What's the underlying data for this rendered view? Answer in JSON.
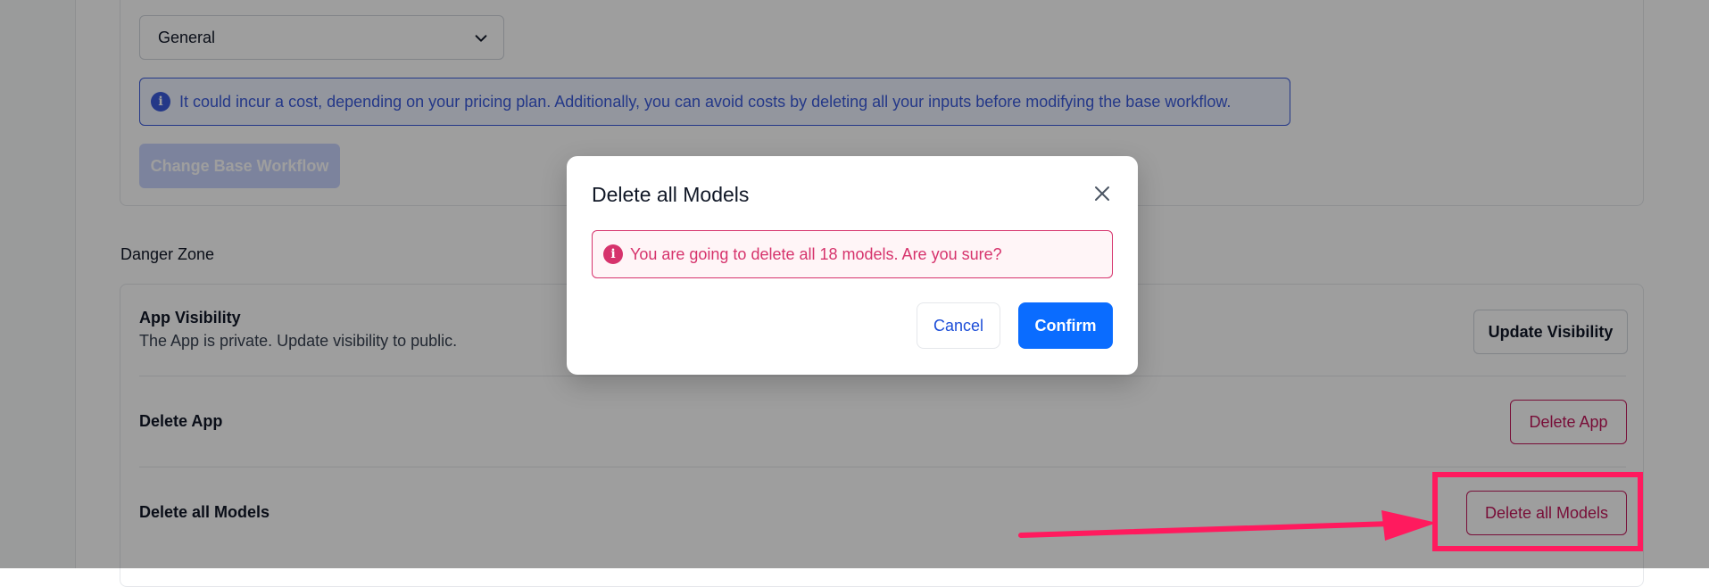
{
  "settings": {
    "select_value": "General",
    "info_text": "It could incur a cost, depending on your pricing plan. Additionally, you can avoid costs by deleting all your inputs before modifying the base workflow.",
    "change_button": "Change Base Workflow"
  },
  "danger_zone": {
    "title": "Danger Zone",
    "visibility_title": "App Visibility",
    "visibility_desc": "The App is private. Update visibility to public.",
    "update_visibility_button": "Update Visibility",
    "delete_app_title": "Delete App",
    "delete_app_button": "Delete App",
    "delete_models_title": "Delete all Models",
    "delete_models_button": "Delete all Models"
  },
  "modal": {
    "title": "Delete all Models",
    "alert": "You are going to delete all 18 models. Are you sure?",
    "cancel": "Cancel",
    "confirm": "Confirm"
  },
  "colors": {
    "primary": "#0a6cff",
    "danger": "#d6336c",
    "info": "#3b5bdb",
    "highlight": "#ff1a5e"
  },
  "icons": [
    "chevron-down-icon",
    "info-icon",
    "close-icon",
    "alert-info-icon",
    "arrow-annotation-icon"
  ]
}
